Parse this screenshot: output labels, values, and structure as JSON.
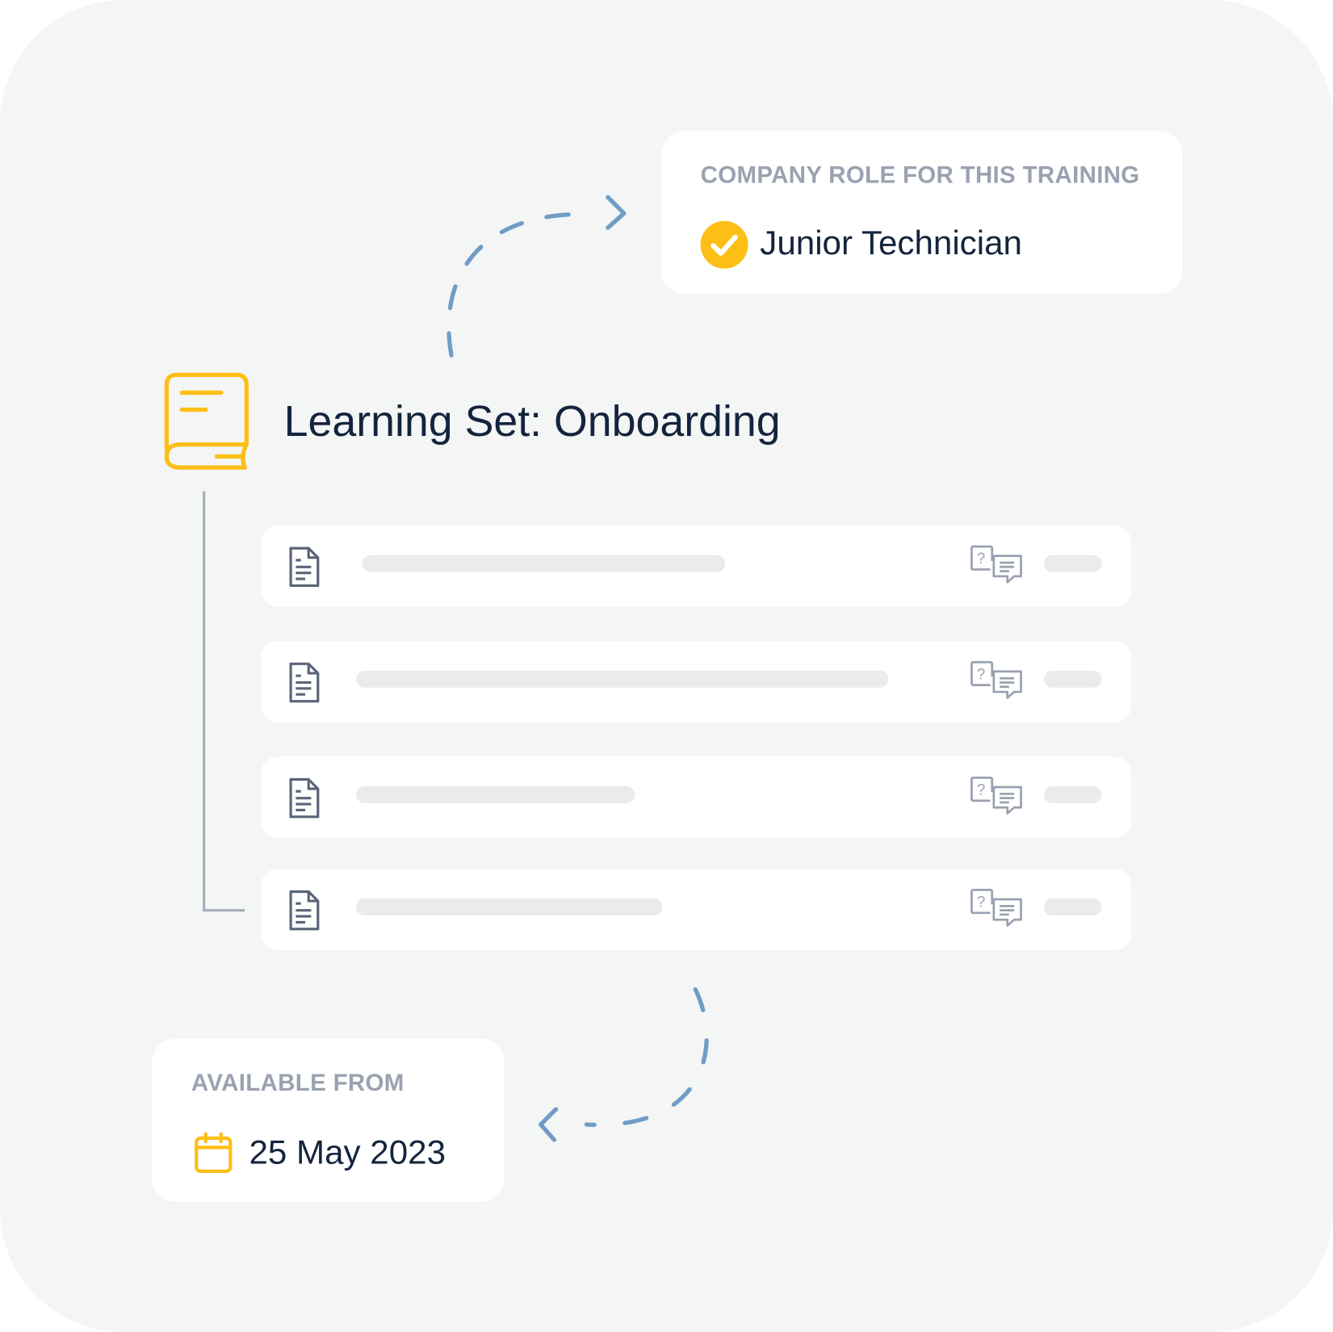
{
  "role_card": {
    "label": "COMPANY ROLE FOR THIS TRAINING",
    "value": "Junior Technician",
    "icon": "check-circle-icon"
  },
  "learning_set": {
    "title": "Learning Set: Onboarding",
    "icon": "book-icon",
    "items": [
      {
        "icon": "document-icon",
        "title_placeholder_fraction": 0.42,
        "action_icon": "question-answer-icon"
      },
      {
        "icon": "document-icon",
        "title_placeholder_fraction": 0.61,
        "action_icon": "question-answer-icon"
      },
      {
        "icon": "document-icon",
        "title_placeholder_fraction": 0.32,
        "action_icon": "question-answer-icon"
      },
      {
        "icon": "document-icon",
        "title_placeholder_fraction": 0.35,
        "action_icon": "question-answer-icon"
      }
    ]
  },
  "availability_card": {
    "label": "AVAILABLE FROM",
    "value": "25 May 2023",
    "icon": "calendar-icon"
  },
  "colors": {
    "accent": "#fdbe15",
    "text_dark": "#14243d",
    "label_gray": "#9aa1b0",
    "arrow_blue": "#6f9dc6",
    "background": "#f4f5f5",
    "placeholder": "#e9ebec",
    "icon_gray": "#5b6478"
  }
}
